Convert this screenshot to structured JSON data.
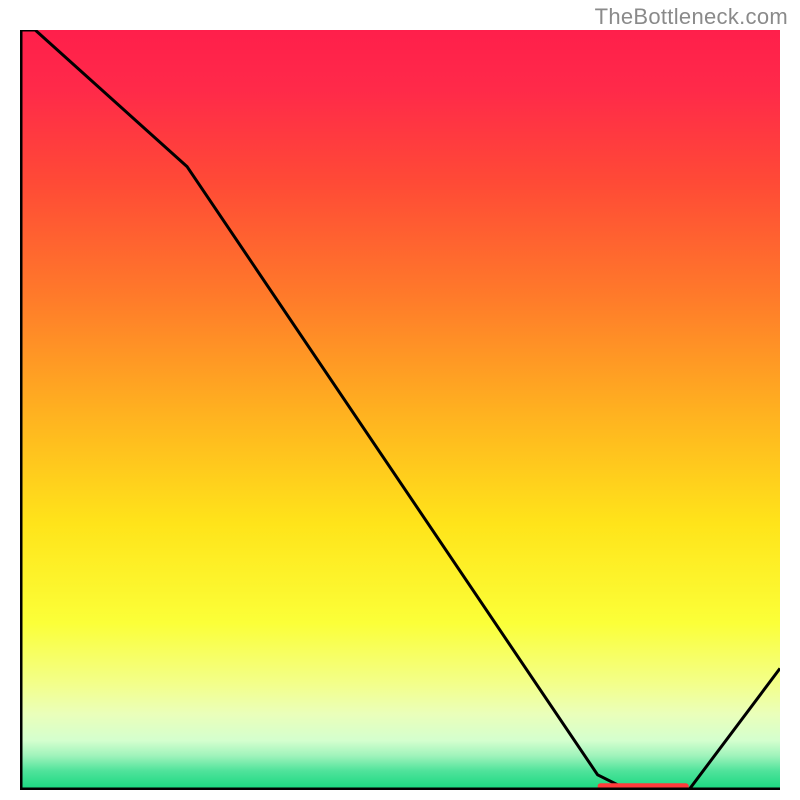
{
  "attribution": "TheBottleneck.com",
  "chart_data": {
    "type": "line",
    "title": "",
    "xlabel": "",
    "ylabel": "",
    "xlim": [
      0,
      100
    ],
    "ylim": [
      0,
      100
    ],
    "x": [
      0,
      2,
      22,
      76,
      80,
      88,
      100
    ],
    "values": [
      100,
      100,
      82,
      2,
      0,
      0,
      16
    ],
    "gradient_stops": [
      {
        "offset": 0.0,
        "color": "#ff1f4b"
      },
      {
        "offset": 0.08,
        "color": "#ff2a49"
      },
      {
        "offset": 0.2,
        "color": "#ff4a36"
      },
      {
        "offset": 0.35,
        "color": "#ff7a2a"
      },
      {
        "offset": 0.5,
        "color": "#ffb020"
      },
      {
        "offset": 0.65,
        "color": "#ffe41a"
      },
      {
        "offset": 0.78,
        "color": "#fbff38"
      },
      {
        "offset": 0.86,
        "color": "#f3ff8a"
      },
      {
        "offset": 0.9,
        "color": "#eaffba"
      },
      {
        "offset": 0.935,
        "color": "#d4ffce"
      },
      {
        "offset": 0.955,
        "color": "#9ff3bb"
      },
      {
        "offset": 0.975,
        "color": "#4fe39b"
      },
      {
        "offset": 1.0,
        "color": "#17d77f"
      }
    ],
    "curve_color": "#000000",
    "curve_width": 3,
    "axis_color": "#000000",
    "axis_width": 5,
    "flat_marker": {
      "y": 0.5,
      "x0": 76,
      "x1": 88,
      "color": "#ff3b3b",
      "height": 6
    }
  }
}
